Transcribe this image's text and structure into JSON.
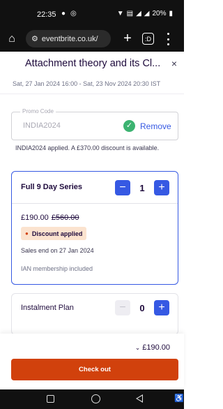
{
  "status_bar": {
    "time": "22:35",
    "battery": "20%",
    "icons": [
      "location-icon",
      "record-icon",
      "wifi-icon",
      "volte-icon",
      "signal-icon",
      "signal-icon",
      "battery-icon"
    ]
  },
  "browser": {
    "url": "eventbrite.co.uk/",
    "new_tab": "+",
    "tab_count": ":D"
  },
  "modal": {
    "title": "Attachment theory and its Cl...",
    "close": "×",
    "date_range": "Sat, 27 Jan 2024 16:00 - Sat, 23 Nov 2024 20:30 IST"
  },
  "promo": {
    "legend": "Promo Code",
    "value": "INDIA2024",
    "remove_label": "Remove",
    "message": "INDIA2024 applied. A £370.00 discount is available."
  },
  "tickets": [
    {
      "name": "Full 9 Day Series",
      "quantity": "1",
      "price": "£190.00",
      "original_price": "£560.00",
      "badge": "Discount applied",
      "sales_end": "Sales end on 27 Jan 2024",
      "note": "IAN membership included"
    },
    {
      "name": "Instalment Plan",
      "quantity": "0"
    }
  ],
  "stepper": {
    "minus": "−",
    "plus": "+"
  },
  "footer": {
    "total": "£190.00",
    "checkout_label": "Check out"
  },
  "colors": {
    "accent_blue": "#3659e3",
    "checkout_orange": "#d1410c",
    "success_green": "#3cb371",
    "badge_bg": "#fbe3cf"
  }
}
